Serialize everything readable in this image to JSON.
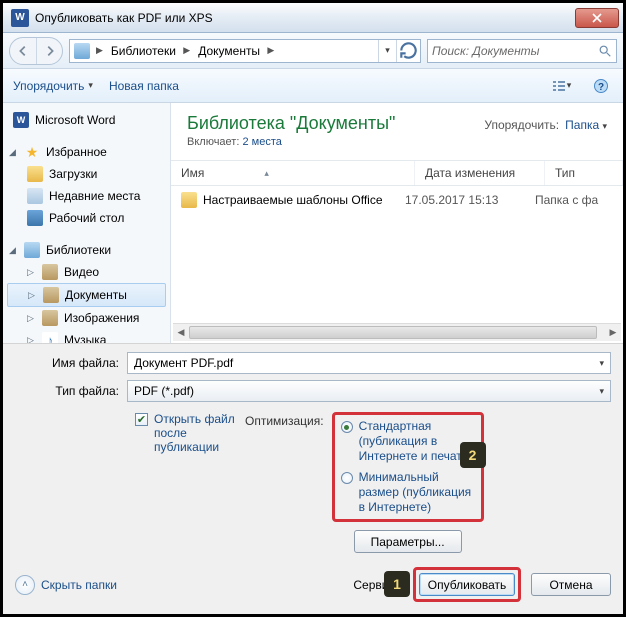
{
  "title": "Опубликовать как PDF или XPS",
  "breadcrumb": {
    "seg1": "Библиотеки",
    "seg2": "Документы"
  },
  "search_placeholder": "Поиск: Документы",
  "toolbar": {
    "organize": "Упорядочить",
    "new_folder": "Новая папка"
  },
  "sidebar": {
    "word": "Microsoft Word",
    "favorites": "Избранное",
    "fav_items": {
      "downloads": "Загрузки",
      "recent": "Недавние места",
      "desktop": "Рабочий стол"
    },
    "libraries": "Библиотеки",
    "lib_items": {
      "video": "Видео",
      "documents": "Документы",
      "images": "Изображения",
      "music": "Музыка"
    }
  },
  "content": {
    "title": "Библиотека \"Документы\"",
    "includes_label": "Включает:",
    "includes_link": "2 места",
    "arrange_label": "Упорядочить:",
    "arrange_value": "Папка",
    "columns": {
      "name": "Имя",
      "date": "Дата изменения",
      "type": "Тип"
    },
    "row": {
      "name": "Настраиваемые шаблоны Office",
      "date": "17.05.2017 15:13",
      "type": "Папка с фа"
    }
  },
  "fields": {
    "filename_label": "Имя файла:",
    "filename_value": "Документ PDF.pdf",
    "filetype_label": "Тип файла:",
    "filetype_value": "PDF (*.pdf)"
  },
  "options": {
    "open_after": "Открыть файл после публикации",
    "optimize_label": "Оптимизация:",
    "radio_standard": "Стандартная (публикация в Интернете и печать)",
    "radio_minimal": "Минимальный размер (публикация в Интернете)",
    "params_btn": "Параметры..."
  },
  "footer": {
    "hide_folders": "Скрыть папки",
    "service": "Сервис",
    "publish": "Опубликовать",
    "cancel": "Отмена"
  },
  "annotations": {
    "one": "1",
    "two": "2"
  }
}
